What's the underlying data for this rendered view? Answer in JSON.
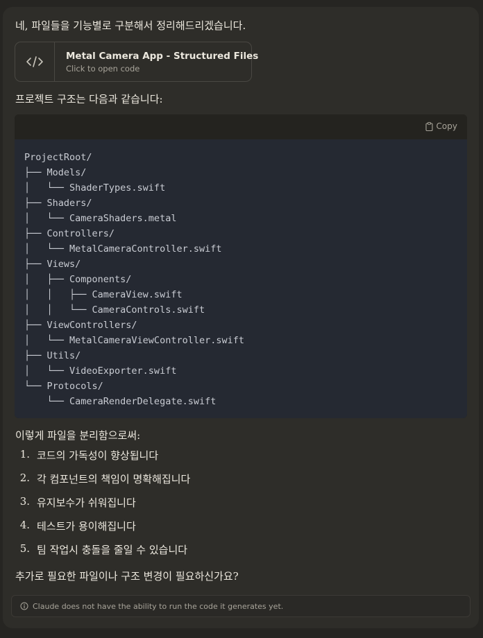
{
  "message": {
    "intro": "네, 파일들을 기능별로 구분해서 정리해드리겠습니다.",
    "artifact": {
      "icon": "code-icon",
      "title": "Metal Camera App - Structured Files",
      "subtitle": "Click to open code"
    },
    "structure_heading": "프로젝트 구조는 다음과 같습니다:",
    "code_block": {
      "copy_label": "Copy",
      "lines": [
        "ProjectRoot/",
        "├── Models/",
        "│   └── ShaderTypes.swift",
        "├── Shaders/",
        "│   └── CameraShaders.metal",
        "├── Controllers/",
        "│   └── MetalCameraController.swift",
        "├── Views/",
        "│   ├── Components/",
        "│   │   ├── CameraView.swift",
        "│   │   └── CameraControls.swift",
        "├── ViewControllers/",
        "│   └── MetalCameraViewController.swift",
        "├── Utils/",
        "│   └── VideoExporter.swift",
        "└── Protocols/",
        "    └── CameraRenderDelegate.swift"
      ]
    },
    "benefits_heading": "이렇게 파일을 분리함으로써:",
    "benefits": [
      {
        "num": "1.",
        "text": "코드의 가독성이 향상됩니다"
      },
      {
        "num": "2.",
        "text": "각 컴포넌트의 책임이 명확해집니다"
      },
      {
        "num": "3.",
        "text": "유지보수가 쉬워집니다"
      },
      {
        "num": "4.",
        "text": "테스트가 용이해집니다"
      },
      {
        "num": "5.",
        "text": "팀 작업시 충돌을 줄일 수 있습니다"
      }
    ],
    "closing": "추가로 필요한 파일이나 구조 변경이 필요하신가요?",
    "disclaimer": "Claude does not have the ability to run the code it generates yet."
  },
  "colors": {
    "page_background": "#262522",
    "message_background": "#2e2d29",
    "code_background": "#252932",
    "text": "#ece8de",
    "muted_text": "#a8a49a"
  }
}
